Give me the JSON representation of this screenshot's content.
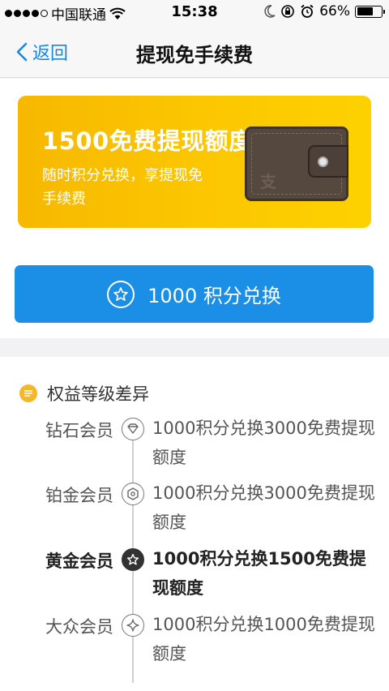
{
  "status_bar": {
    "carrier": "中国联通",
    "time": "15:38",
    "battery_percent": "66%",
    "battery_level": 0.66,
    "signal_bars": 4
  },
  "nav": {
    "back_label": "返回",
    "title": "提现免手续费"
  },
  "banner": {
    "title": "1500免费提现额度",
    "subtitle": "随时积分兑换，享提现免手续费",
    "wallet_logo": "支"
  },
  "redeem_button": {
    "label": "1000 积分兑换"
  },
  "levels_section": {
    "title": "权益等级差异",
    "levels": [
      {
        "name": "钻石会员",
        "desc": "1000积分兑换3000免费提现额度",
        "icon": "diamond-icon",
        "active": false
      },
      {
        "name": "铂金会员",
        "desc": "1000积分兑换3000免费提现额度",
        "icon": "hexagon-icon",
        "active": false
      },
      {
        "name": "黄金会员",
        "desc": "1000积分兑换1500免费提现额度",
        "icon": "star-icon",
        "active": true
      },
      {
        "name": "大众会员",
        "desc": "1000积分兑换1000免费提现额度",
        "icon": "sparkle-icon",
        "active": false
      }
    ]
  },
  "colors": {
    "accent_blue": "#1b8fe6",
    "banner_yellow": "#fcc700",
    "badge_orange": "#f3b728"
  }
}
